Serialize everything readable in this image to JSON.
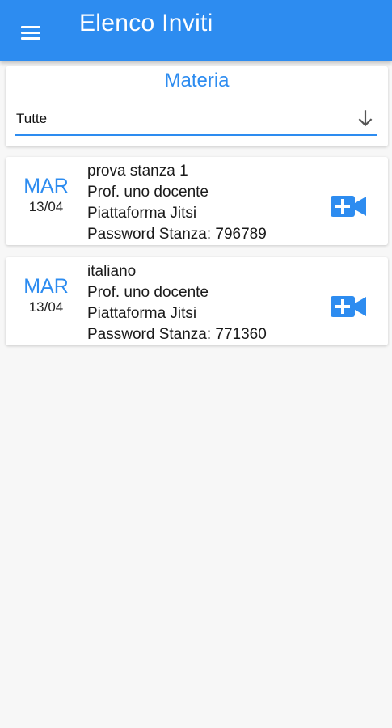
{
  "app_bar": {
    "title": "Elenco Inviti",
    "menu_icon": "hamburger-menu-icon",
    "color": "#2d8cf0"
  },
  "filter": {
    "label": "Materia",
    "selected": "Tutte",
    "icon": "arrow-down-icon"
  },
  "invites": [
    {
      "day_name": "MAR",
      "date": "13/04",
      "subject": "prova stanza 1",
      "teacher": "Prof. uno docente",
      "platform": "Piattaforma Jitsi",
      "password": "Password Stanza: 796789",
      "action_icon": "video-call-add-icon"
    },
    {
      "day_name": "MAR",
      "date": "13/04",
      "subject": "italiano",
      "teacher": "Prof. uno docente",
      "platform": "Piattaforma Jitsi",
      "password": "Password Stanza: 771360",
      "action_icon": "video-call-add-icon"
    }
  ]
}
